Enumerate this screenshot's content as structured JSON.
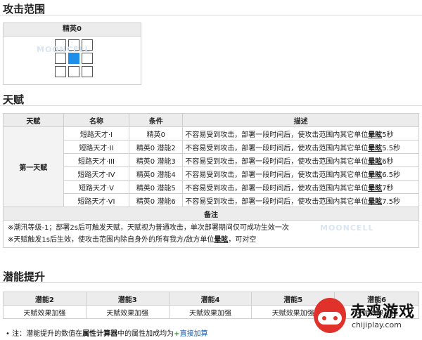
{
  "range_section": {
    "title": "攻击范围",
    "phase_label": "精英0"
  },
  "talent_section": {
    "title": "天赋",
    "headers": [
      "天赋",
      "名称",
      "条件",
      "描述"
    ],
    "group_label": "第一天赋",
    "rows": [
      {
        "name": "短路天才·I",
        "cond": "精英0",
        "desc": "不容易受到攻击，部署一段时间后，使攻击范围内其它单位",
        "bold": "晕眩",
        "dur": "5秒"
      },
      {
        "name": "短路天才·II",
        "cond": "精英0 潜能2",
        "desc": "不容易受到攻击，部署一段时间后，使攻击范围内其它单位",
        "bold": "晕眩",
        "dur": "5.5秒"
      },
      {
        "name": "短路天才·III",
        "cond": "精英0 潜能3",
        "desc": "不容易受到攻击，部署一段时间后，使攻击范围内其它单位",
        "bold": "晕眩",
        "dur": "6秒"
      },
      {
        "name": "短路天才·IV",
        "cond": "精英0 潜能4",
        "desc": "不容易受到攻击，部署一段时间后，使攻击范围内其它单位",
        "bold": "晕眩",
        "dur": "6.5秒"
      },
      {
        "name": "短路天才·V",
        "cond": "精英0 潜能5",
        "desc": "不容易受到攻击，部署一段时间后，使攻击范围内其它单位",
        "bold": "晕眩",
        "dur": "7秒"
      },
      {
        "name": "短路天才·VI",
        "cond": "精英0 潜能6",
        "desc": "不容易受到攻击，部署一段时间后，使攻击范围内其它单位",
        "bold": "晕眩",
        "dur": "7.5秒"
      }
    ],
    "notes_header": "备注",
    "note1": "※潮汛等级-1；部署2s后可触发天赋，天赋视为普通攻击，单次部署期间仅可成功生效一次",
    "note2_a": "※天赋触发1s后生效，使攻击范围内除自身外的所有我方/敌方单位",
    "note2_bold": "晕眩",
    "note2_b": "，可对空"
  },
  "potential_section": {
    "title": "潜能提升",
    "headers": [
      "潜能2",
      "潜能3",
      "潜能4",
      "潜能5",
      "潜能6"
    ],
    "values": [
      "天赋效果加强",
      "天赋效果加强",
      "天赋效果加强",
      "天赋效果加强",
      "天赋效果加强"
    ]
  },
  "footnote": {
    "bullet": "•",
    "prefix": "注：潜能提升的数值在",
    "bold": "属性计算器",
    "middle": "中的属性加成均为",
    "plus": "+",
    "link": "直接加算"
  },
  "watermark": "MOONCELL",
  "brand": {
    "name": "赤鸡游戏",
    "url": "chijiplay.com",
    "color": "#e0312b"
  }
}
